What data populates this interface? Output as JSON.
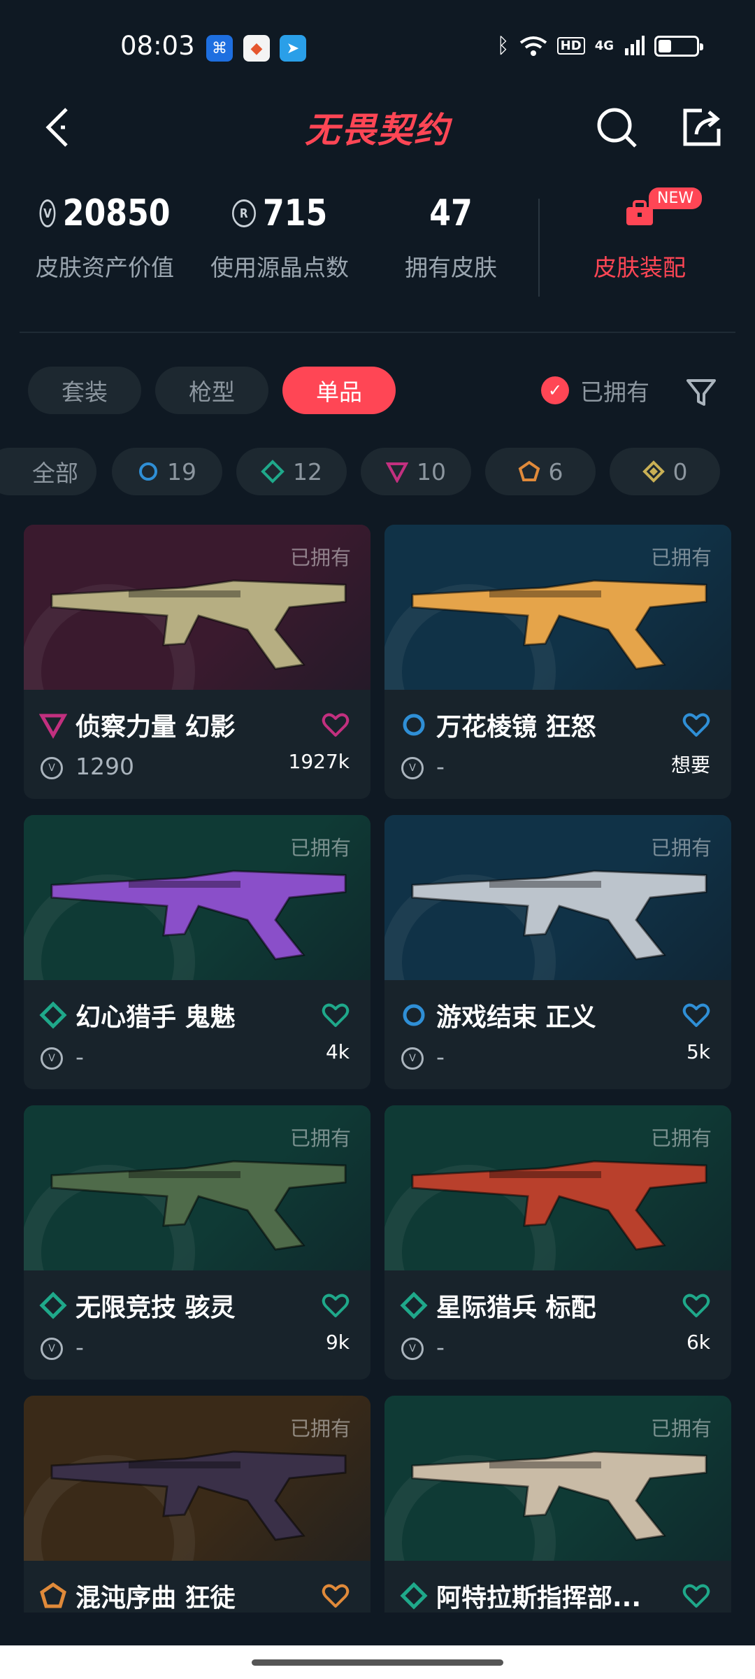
{
  "status_bar": {
    "time": "08:03",
    "network": "4G"
  },
  "header": {
    "title": "无畏契约"
  },
  "stats": [
    {
      "value": "20850",
      "label": "皮肤资产价值",
      "icon": "vp-coin-icon"
    },
    {
      "value": "715",
      "label": "使用源晶点数",
      "icon": "radianite-icon"
    },
    {
      "value": "47",
      "label": "拥有皮肤"
    }
  ],
  "loadout": {
    "badge": "NEW",
    "label": "皮肤装配"
  },
  "tabs": [
    {
      "label": "套装",
      "active": false
    },
    {
      "label": "枪型",
      "active": false
    },
    {
      "label": "单品",
      "active": true
    }
  ],
  "owned_filter": {
    "label": "已拥有",
    "checked": true
  },
  "tiers": [
    {
      "label": "全部",
      "count": ""
    },
    {
      "label": "",
      "count": "19",
      "color": "#2f8fd6",
      "icon": "select-tier-icon"
    },
    {
      "label": "",
      "count": "12",
      "color": "#1fa88a",
      "icon": "deluxe-tier-icon"
    },
    {
      "label": "",
      "count": "10",
      "color": "#c2307f",
      "icon": "premium-tier-icon"
    },
    {
      "label": "",
      "count": "6",
      "color": "#e08a3a",
      "icon": "exclusive-tier-icon"
    },
    {
      "label": "",
      "count": "0",
      "color": "#c9b055",
      "icon": "ultra-tier-icon"
    }
  ],
  "skins": [
    {
      "name": "侦察力量 幻影",
      "owned": "已拥有",
      "price": "1290",
      "likes": "1927k",
      "tier_color": "#c2307f",
      "tier_shape": "triangle",
      "heart_color": "#c2307f",
      "bg": "#3a1a2e",
      "gun_color": "#b6ae82"
    },
    {
      "name": "万花棱镜 狂怒",
      "owned": "已拥有",
      "price": "-",
      "likes": "想要",
      "tier_color": "#2f8fd6",
      "tier_shape": "ring",
      "heart_color": "#2f8fd6",
      "bg": "#103247",
      "gun_color": "#e5a44a"
    },
    {
      "name": "幻心猎手 鬼魅",
      "owned": "已拥有",
      "price": "-",
      "likes": "4k",
      "tier_color": "#1fa88a",
      "tier_shape": "diamond",
      "heart_color": "#1fa88a",
      "bg": "#0f3a35",
      "gun_color": "#8a4fc9"
    },
    {
      "name": "游戏结束 正义",
      "owned": "已拥有",
      "price": "-",
      "likes": "5k",
      "tier_color": "#2f8fd6",
      "tier_shape": "ring",
      "heart_color": "#2f8fd6",
      "bg": "#103247",
      "gun_color": "#bcc4cc"
    },
    {
      "name": "无限竞技 骇灵",
      "owned": "已拥有",
      "price": "-",
      "likes": "9k",
      "tier_color": "#1fa88a",
      "tier_shape": "diamond",
      "heart_color": "#1fa88a",
      "bg": "#0f3a35",
      "gun_color": "#4f6b4a"
    },
    {
      "name": "星际猎兵 标配",
      "owned": "已拥有",
      "price": "-",
      "likes": "6k",
      "tier_color": "#1fa88a",
      "tier_shape": "diamond",
      "heart_color": "#1fa88a",
      "bg": "#0f3a35",
      "gun_color": "#b9402c"
    },
    {
      "name": "混沌序曲 狂徒",
      "owned": "已拥有",
      "price": "",
      "likes": "",
      "tier_color": "#e08a3a",
      "tier_shape": "pentagon",
      "heart_color": "#e08a3a",
      "bg": "#3a2a18",
      "gun_color": "#3a3048"
    },
    {
      "name": "阿特拉斯指挥部...",
      "owned": "已拥有",
      "price": "",
      "likes": "",
      "tier_color": "#1fa88a",
      "tier_shape": "diamond",
      "heart_color": "#1fa88a",
      "bg": "#0f3a35",
      "gun_color": "#c9bba6"
    }
  ]
}
